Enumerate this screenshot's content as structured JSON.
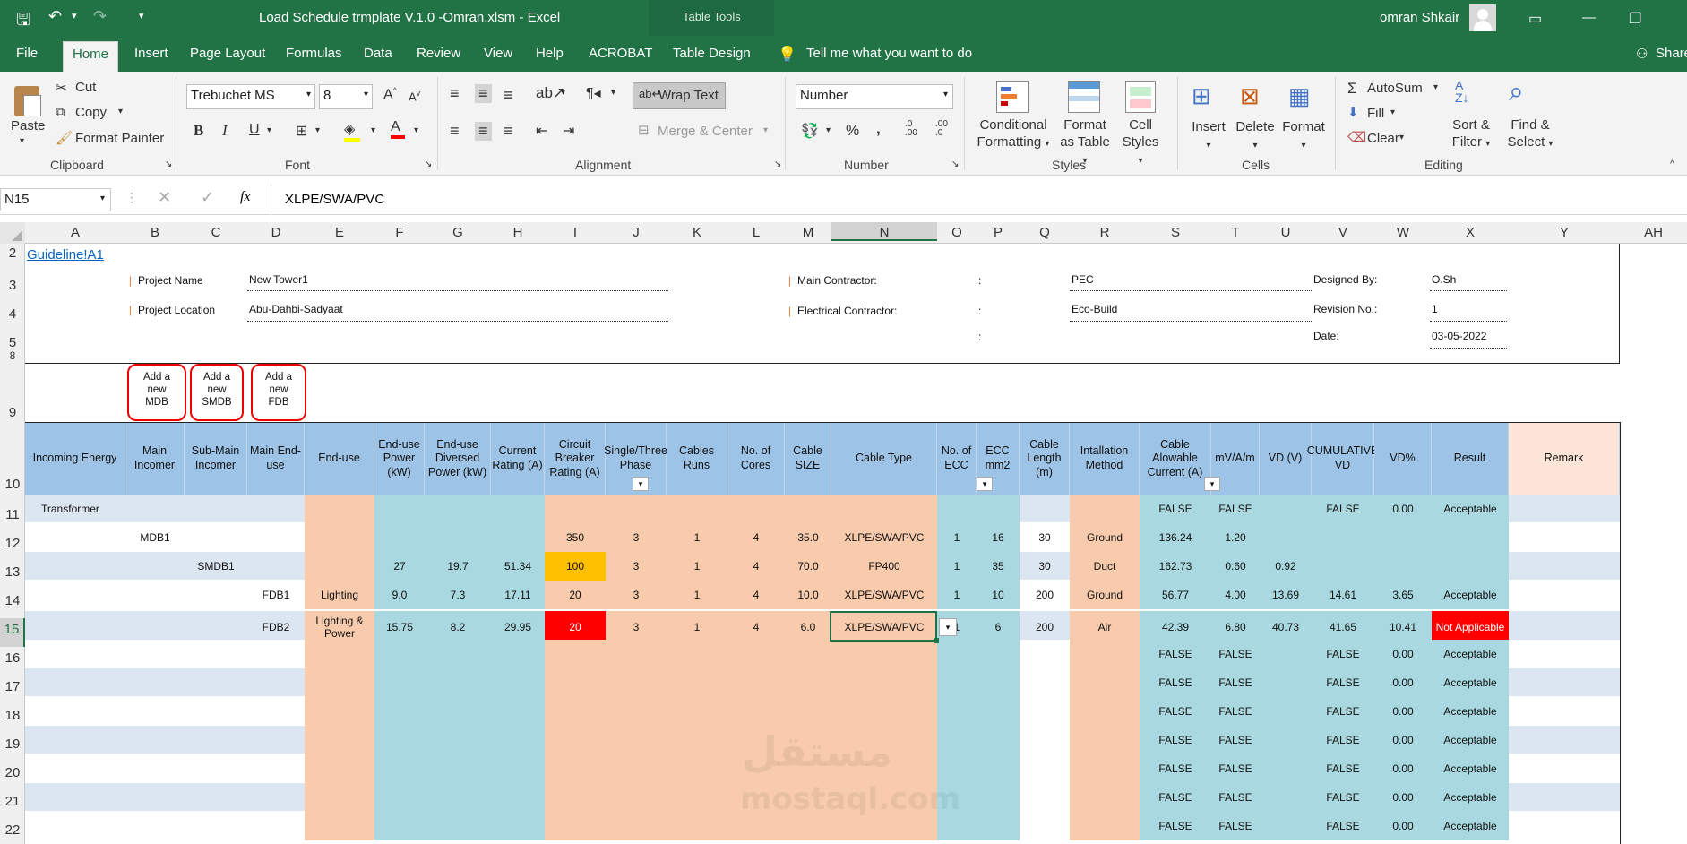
{
  "window": {
    "title": "Load Schedule trmplate V.1.0 -Omran.xlsm  -  Excel",
    "context_tab": "Table Tools",
    "user": "omran Shkair"
  },
  "tabs": [
    {
      "label": "File"
    },
    {
      "label": "Home"
    },
    {
      "label": "Insert"
    },
    {
      "label": "Page Layout"
    },
    {
      "label": "Formulas"
    },
    {
      "label": "Data"
    },
    {
      "label": "Review"
    },
    {
      "label": "View"
    },
    {
      "label": "Help"
    },
    {
      "label": "ACROBAT"
    },
    {
      "label": "Table Design"
    }
  ],
  "tell_me": "Tell me what you want to do",
  "share": "Share",
  "ribbon": {
    "clipboard": {
      "paste": "Paste",
      "cut": "Cut",
      "copy": "Copy",
      "format_painter": "Format Painter",
      "group": "Clipboard"
    },
    "font": {
      "family": "Trebuchet MS",
      "size": "8",
      "group": "Font",
      "bold": "B",
      "italic": "I",
      "underline": "U"
    },
    "alignment": {
      "wrap_text": "Wrap Text",
      "merge_center": "Merge & Center",
      "group": "Alignment"
    },
    "number": {
      "format": "Number",
      "group": "Number"
    },
    "styles": {
      "conditional": "Conditional Formatting",
      "format_table": "Format as Table",
      "cell_styles": "Cell Styles",
      "group": "Styles"
    },
    "cells": {
      "insert": "Insert",
      "delete": "Delete",
      "format": "Format",
      "group": "Cells"
    },
    "editing": {
      "autosum": "AutoSum",
      "fill": "Fill",
      "clear": "Clear",
      "sort": "Sort & Filter",
      "find": "Find & Select",
      "group": "Editing"
    }
  },
  "formula_bar": {
    "name_box": "N15",
    "value": "XLPE/SWA/PVC"
  },
  "columns": [
    "A",
    "B",
    "C",
    "D",
    "E",
    "F",
    "G",
    "H",
    "I",
    "J",
    "K",
    "L",
    "M",
    "N",
    "O",
    "P",
    "Q",
    "R",
    "S",
    "T",
    "U",
    "V",
    "W",
    "X",
    "Y",
    "AH"
  ],
  "rows": [
    "2",
    "3",
    "4",
    "5",
    "8",
    "9",
    "10",
    "11",
    "12",
    "13",
    "14",
    "15",
    "16",
    "17",
    "18",
    "19",
    "20",
    "21",
    "22"
  ],
  "project": {
    "link": "Guideline!A1",
    "name_label": "Project Name",
    "name": "New Tower1",
    "location_label": "Project Location",
    "location": "Abu-Dahbi-Sadyaat",
    "main_contractor_label": "Main Contractor:",
    "main_contractor": "PEC",
    "elec_contractor_label": "Electrical Contractor:",
    "elec_contractor": "Eco-Build",
    "colon": ":",
    "designed_label": "Designed By:",
    "designed": "O.Sh",
    "revision_label": "Revision No.:",
    "revision": "1",
    "date_label": "Date:",
    "date": "03-05-2022"
  },
  "add_buttons": [
    {
      "l1": "Add a",
      "l2": "new",
      "l3": "MDB"
    },
    {
      "l1": "Add a",
      "l2": "new",
      "l3": "SMDB"
    },
    {
      "l1": "Add a",
      "l2": "new",
      "l3": "FDB"
    }
  ],
  "headers": [
    "Incoming Energy",
    "Main Incomer",
    "Sub-Main Incomer",
    "Main End-use",
    "End-use",
    "End-use Power (kW)",
    "End-use Diversed Power (kW)",
    "Current Rating (A)",
    "Circuit Breaker Rating (A)",
    "Single/Three Phase",
    "Cables Runs",
    "No. of Cores",
    "Cable SIZE",
    "Cable Type",
    "No. of ECC",
    "ECC mm2",
    "Cable Length (m)",
    "Intallation Method",
    "Cable Alowable Current (A)",
    "mV/A/m",
    "VD (V)",
    "CUMULATIVE VD",
    "VD%",
    "Result",
    "Remark"
  ],
  "data_rows": [
    {
      "a": "Transformer",
      "s": "FALSE",
      "t": "FALSE",
      "v": "FALSE",
      "w": "0.00",
      "x": "Acceptable"
    },
    {
      "b": "MDB1",
      "i": "350",
      "j": "3",
      "k": "1",
      "l": "4",
      "m": "35.0",
      "n": "XLPE/SWA/PVC",
      "o": "1",
      "p": "16",
      "q": "30",
      "r": "Ground",
      "s": "136.24",
      "t": "1.20"
    },
    {
      "c": "SMDB1",
      "f": "27",
      "g": "19.7",
      "h": "51.34",
      "i": "100",
      "j": "3",
      "k": "1",
      "l": "4",
      "m": "70.0",
      "n": "FP400",
      "o": "1",
      "p": "35",
      "q": "30",
      "r": "Duct",
      "s": "162.73",
      "t": "0.60",
      "u": "0.92"
    },
    {
      "d": "FDB1",
      "e": "Lighting",
      "f": "9.0",
      "g": "7.3",
      "h": "17.11",
      "i": "20",
      "j": "3",
      "k": "1",
      "l": "4",
      "m": "10.0",
      "n": "XLPE/SWA/PVC",
      "o": "1",
      "p": "10",
      "q": "200",
      "r": "Ground",
      "s": "56.77",
      "t": "4.00",
      "u": "13.69",
      "v": "14.61",
      "w": "3.65",
      "x": "Acceptable"
    },
    {
      "d": "FDB2",
      "e": "Lighting & Power",
      "f": "15.75",
      "g": "8.2",
      "h": "29.95",
      "i": "20",
      "j": "3",
      "k": "1",
      "l": "4",
      "m": "6.0",
      "n": "XLPE/SWA/PVC",
      "o": "1",
      "p": "6",
      "q": "200",
      "r": "Air",
      "s": "42.39",
      "t": "6.80",
      "u": "40.73",
      "v": "41.65",
      "w": "10.41",
      "x": "Not Applicable"
    },
    {
      "s": "FALSE",
      "t": "FALSE",
      "v": "FALSE",
      "w": "0.00",
      "x": "Acceptable"
    },
    {
      "s": "FALSE",
      "t": "FALSE",
      "v": "FALSE",
      "w": "0.00",
      "x": "Acceptable"
    },
    {
      "s": "FALSE",
      "t": "FALSE",
      "v": "FALSE",
      "w": "0.00",
      "x": "Acceptable"
    },
    {
      "s": "FALSE",
      "t": "FALSE",
      "v": "FALSE",
      "w": "0.00",
      "x": "Acceptable"
    },
    {
      "s": "FALSE",
      "t": "FALSE",
      "v": "FALSE",
      "w": "0.00",
      "x": "Acceptable"
    },
    {
      "s": "FALSE",
      "t": "FALSE",
      "v": "FALSE",
      "w": "0.00",
      "x": "Acceptable"
    },
    {
      "s": "FALSE",
      "t": "FALSE",
      "v": "FALSE",
      "w": "0.00",
      "x": "Acceptable"
    }
  ],
  "watermark": {
    "l1": "مستقل",
    "l2": "mostaql.com"
  }
}
